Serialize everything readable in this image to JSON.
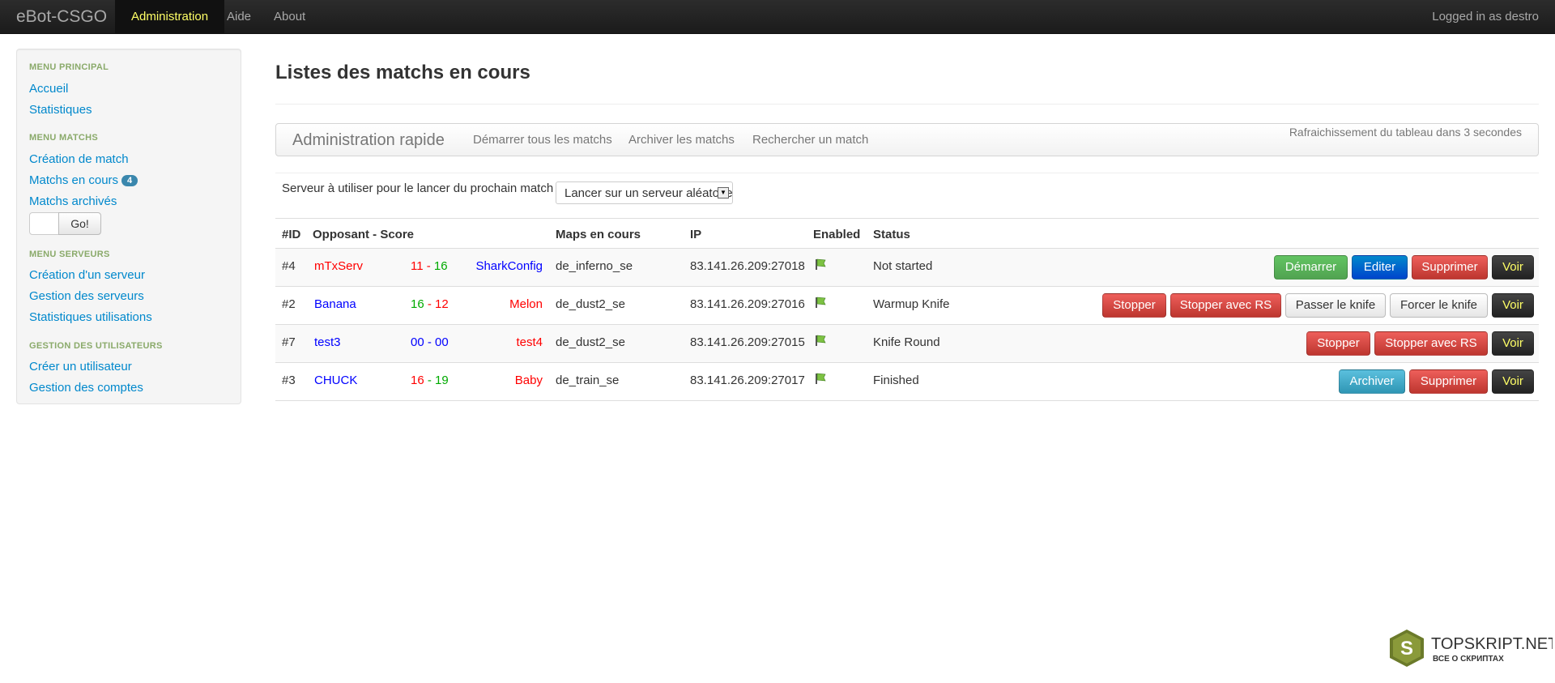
{
  "nav": {
    "brand": "eBot-CSGO",
    "items": [
      "Administration",
      "Aide",
      "About"
    ],
    "logged_in": "Logged in as destro"
  },
  "sidebar": {
    "menu_principal": "MENU PRINCIPAL",
    "accueil": "Accueil",
    "statistiques": "Statistiques",
    "menu_matchs": "MENU MATCHS",
    "creation_match": "Création de match",
    "matchs_en_cours": "Matchs en cours",
    "matchs_en_cours_count": "4",
    "matchs_archives": "Matchs archivés",
    "go_label": "Go!",
    "menu_serveurs": "MENU SERVEURS",
    "creation_serveur": "Création d'un serveur",
    "gestion_serveurs": "Gestion des serveurs",
    "statistiques_utilisations": "Statistiques utilisations",
    "gestion_utilisateurs": "GESTION DES UTILISATEURS",
    "creer_utilisateur": "Créer un utilisateur",
    "gestion_comptes": "Gestion des comptes"
  },
  "main": {
    "title": "Listes des matchs en cours",
    "quick_admin": {
      "title": "Administration rapide",
      "start_all": "Démarrer tous les matchs",
      "archive": "Archiver les matchs",
      "search": "Rechercher un match",
      "refresh": "Rafraichissement du tableau dans 3 secondes"
    },
    "server_label": "Serveur à utiliser pour le lancer du prochain match",
    "server_select": "Lancer sur un serveur aléatoire",
    "columns": {
      "id": "#ID",
      "opponents": "Opposant - Score",
      "maps": "Maps en cours",
      "ip": "IP",
      "enabled": "Enabled",
      "status": "Status"
    },
    "rows": [
      {
        "id": "#4",
        "team_a": "mTxServ",
        "score_a": "11",
        "sep": "-",
        "score_b": "16",
        "team_b": "SharkConfig",
        "map": "de_inferno_se",
        "ip": "83.141.26.209:27018",
        "status": "Not started",
        "buttons": [
          "Démarrer",
          "Editer",
          "Supprimer",
          "Voir"
        ]
      },
      {
        "id": "#2",
        "team_a": "Banana",
        "score_a": "16",
        "sep": "-",
        "score_b": "12",
        "team_b": "Melon",
        "map": "de_dust2_se",
        "ip": "83.141.26.209:27016",
        "status": "Warmup Knife",
        "buttons": [
          "Stopper",
          "Stopper avec RS",
          "Passer le knife",
          "Forcer le knife",
          "Voir"
        ]
      },
      {
        "id": "#7",
        "team_a": "test3",
        "score_a": "00",
        "sep": "-",
        "score_b": "00",
        "team_b": "test4",
        "map": "de_dust2_se",
        "ip": "83.141.26.209:27015",
        "status": "Knife Round",
        "buttons": [
          "Stopper",
          "Stopper avec RS",
          "Voir"
        ]
      },
      {
        "id": "#3",
        "team_a": "CHUCK",
        "score_a": "16",
        "sep": "-",
        "score_b": "19",
        "team_b": "Baby",
        "map": "de_train_se",
        "ip": "83.141.26.209:27017",
        "status": "Finished",
        "buttons": [
          "Archiver",
          "Supprimer",
          "Voir"
        ]
      }
    ]
  },
  "watermark": {
    "name": "TOPSKRIPT.NET",
    "tagline": "ВСЕ О СКРИПТАХ",
    "letter": "S"
  }
}
